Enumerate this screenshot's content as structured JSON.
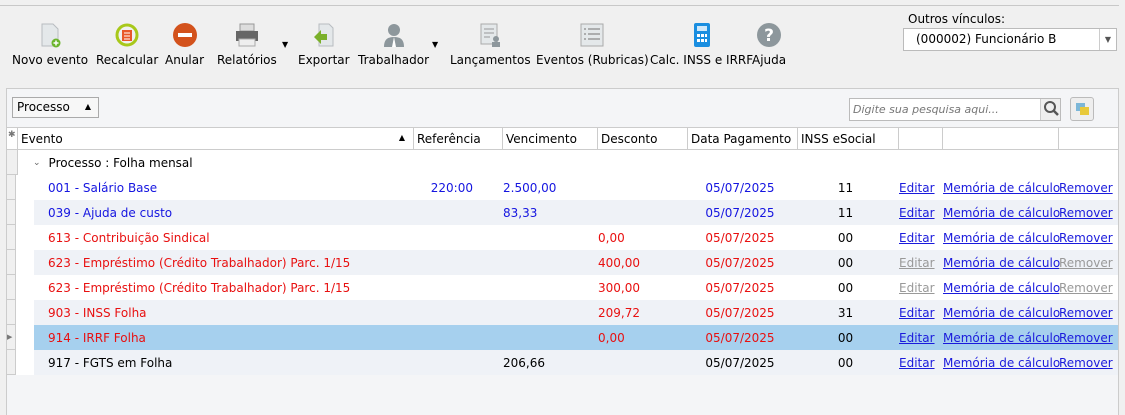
{
  "toolbar": {
    "items": [
      {
        "label": "Novo evento",
        "icon": "new-document-icon"
      },
      {
        "label": "Recalcular",
        "icon": "recalculate-icon"
      },
      {
        "label": "Anular",
        "icon": "cancel-icon"
      },
      {
        "label": "Relatórios",
        "icon": "printer-icon"
      },
      {
        "label": "Exportar",
        "icon": "export-icon"
      },
      {
        "label": "Trabalhador",
        "icon": "worker-icon"
      },
      {
        "label": "Lançamentos",
        "icon": "entries-icon"
      },
      {
        "label": "Eventos (Rubricas)",
        "icon": "list-icon"
      },
      {
        "label": "Calc. INSS e IRRF",
        "icon": "calculator-icon"
      },
      {
        "label": "Ajuda",
        "icon": "help-icon"
      }
    ]
  },
  "vinculos": {
    "label": "Outros vínculos:",
    "value": "(000002) Funcionário B"
  },
  "group_by": "Processo",
  "search": {
    "placeholder": "Digite sua pesquisa aqui..."
  },
  "columns": [
    "Evento",
    "Referência",
    "Vencimento",
    "Desconto",
    "Data Pagamento",
    "INSS eSocial"
  ],
  "group": "Processo : Folha mensal",
  "links": {
    "edit": "Editar",
    "memo": "Memória de cálculo",
    "remove": "Remover"
  },
  "rows": [
    {
      "evento": "001 - Salário Base",
      "ref": "220:00",
      "venc": "2.500,00",
      "desc": "",
      "data": "05/07/2025",
      "inss": "11",
      "color": "blue",
      "enabled": true
    },
    {
      "evento": "039 - Ajuda de custo",
      "ref": "",
      "venc": "83,33",
      "desc": "",
      "data": "05/07/2025",
      "inss": "11",
      "color": "blue",
      "enabled": true
    },
    {
      "evento": "613 - Contribuição Sindical",
      "ref": "",
      "venc": "",
      "desc": "0,00",
      "data": "05/07/2025",
      "inss": "00",
      "color": "red",
      "enabled": true
    },
    {
      "evento": "623 - Empréstimo (Crédito Trabalhador) Parc. 1/15",
      "ref": "",
      "venc": "",
      "desc": "400,00",
      "data": "05/07/2025",
      "inss": "00",
      "color": "red",
      "enabled": false
    },
    {
      "evento": "623 - Empréstimo (Crédito Trabalhador) Parc. 1/15",
      "ref": "",
      "venc": "",
      "desc": "300,00",
      "data": "05/07/2025",
      "inss": "00",
      "color": "red",
      "enabled": false
    },
    {
      "evento": "903 - INSS Folha",
      "ref": "",
      "venc": "",
      "desc": "209,72",
      "data": "05/07/2025",
      "inss": "31",
      "color": "red",
      "enabled": true
    },
    {
      "evento": "914 - IRRF Folha",
      "ref": "",
      "venc": "",
      "desc": "0,00",
      "data": "05/07/2025",
      "inss": "00",
      "color": "red",
      "enabled": true,
      "selected": true
    },
    {
      "evento": "917 - FGTS em Folha",
      "ref": "",
      "venc": "206,66",
      "desc": "",
      "data": "05/07/2025",
      "inss": "00",
      "color": "blk",
      "enabled": true
    }
  ]
}
